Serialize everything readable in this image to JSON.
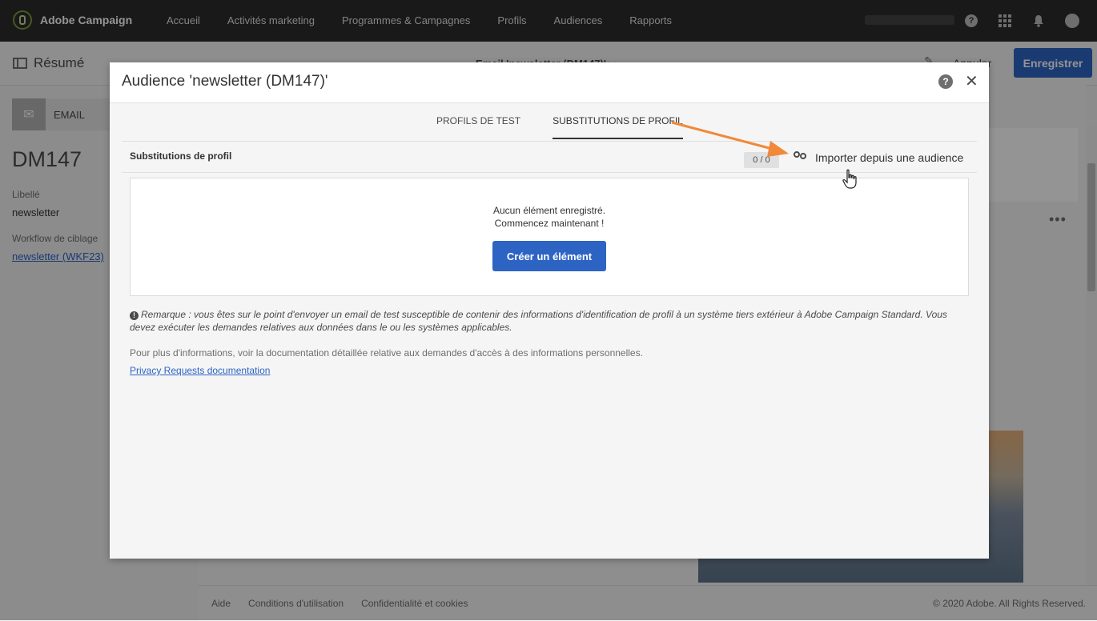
{
  "app": {
    "brand": "Adobe Campaign",
    "nav": [
      "Accueil",
      "Activités marketing",
      "Programmes & Campagnes",
      "Profils",
      "Audiences",
      "Rapports"
    ],
    "help_glyph": "?"
  },
  "background": {
    "resume": "Résumé",
    "page_title": "Email 'newsletter (DM147)' ▸▸",
    "cancel_label": "Annuler",
    "save_label": "Enregistrer",
    "channel_label": "EMAIL",
    "dm_title": "DM147",
    "label_caption": "Libellé",
    "label_value": "newsletter",
    "workflow_caption": "Workflow de ciblage",
    "workflow_link": "newsletter (WKF23)",
    "footer_links": [
      "Aide",
      "Conditions d'utilisation",
      "Confidentialité et cookies"
    ],
    "copyright": "© 2020 Adobe. All Rights Reserved."
  },
  "modal": {
    "title": "Audience 'newsletter (DM147)'",
    "help_glyph": "?",
    "close_glyph": "✕",
    "tabs": [
      {
        "label": "PROFILS DE TEST",
        "active": false
      },
      {
        "label": "SUBSTITUTIONS DE PROFIL",
        "active": true
      }
    ],
    "section_title": "Substitutions de profil",
    "counter": "0 / 0",
    "import_label": "Importer depuis une audience",
    "empty_line1": "Aucun élément enregistré.",
    "empty_line2": "Commencez maintenant !",
    "create_label": "Créer un élément",
    "info_glyph": "!",
    "remark": "Remarque : vous êtes sur le point d'envoyer un email de test susceptible de contenir des informations d'identification de profil à un système tiers extérieur à Adobe Campaign Standard. Vous devez exécuter les demandes relatives aux données dans le ou les systèmes applicables.",
    "more_info": "Pour plus d'informations, voir la documentation détaillée relative aux demandes d'accès à des informations personnelles.",
    "doc_link": "Privacy Requests documentation"
  },
  "colors": {
    "accent": "#2d64c4",
    "annotation_arrow": "#f0893a",
    "topbar": "#2c2c2c"
  },
  "icons": [
    "adobe-campaign-logo-icon",
    "help-icon",
    "apps-grid-icon",
    "bell-icon",
    "avatar-icon",
    "panel-icon",
    "envelope-icon",
    "edit-icon",
    "more-icon",
    "group-icon",
    "info-icon",
    "close-icon",
    "hand-cursor-icon"
  ]
}
